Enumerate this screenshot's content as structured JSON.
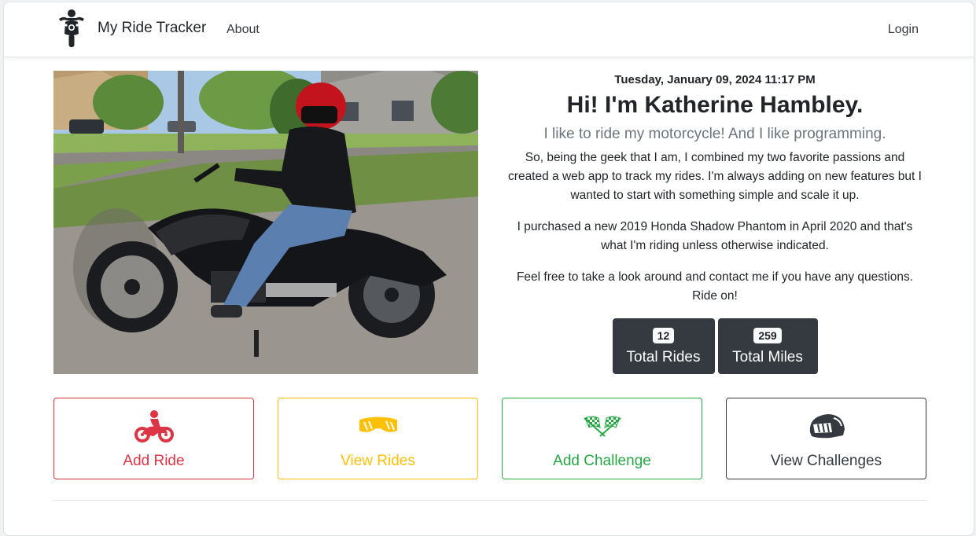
{
  "navbar": {
    "brand": "My Ride Tracker",
    "about_label": "About",
    "login_label": "Login"
  },
  "intro": {
    "datetime": "Tuesday, January 09, 2024 11:17 PM",
    "greeting": "Hi! I'm Katherine Hambley.",
    "tagline": "I like to ride my motorcycle! And I like programming.",
    "paragraphs": [
      "So, being the geek that I am, I combined my two favorite passions and created a web app to track my rides. I'm always adding on new features but I wanted to start with something simple and scale it up.",
      "I purchased a new 2019 Honda Shadow Phantom in April 2020 and that's what I'm riding unless otherwise indicated.",
      "Feel free to take a look around and contact me if you have any questions. Ride on!"
    ]
  },
  "stats": {
    "rides_count": "12",
    "rides_label": "Total Rides",
    "miles_count": "259",
    "miles_label": "Total Miles"
  },
  "actions": [
    {
      "label": "Add Ride",
      "icon": "motorcycle-rider-icon",
      "color": "#dc3545"
    },
    {
      "label": "View Rides",
      "icon": "goggles-icon",
      "color": "#ffc107"
    },
    {
      "label": "Add Challenge",
      "icon": "checkered-flags-icon",
      "color": "#28a745"
    },
    {
      "label": "View Challenges",
      "icon": "helmet-icon",
      "color": "#343a40"
    }
  ],
  "colors": {
    "dark": "#343a40",
    "muted": "#6c757d",
    "danger": "#dc3545",
    "warning": "#ffc107",
    "success": "#28a745"
  }
}
